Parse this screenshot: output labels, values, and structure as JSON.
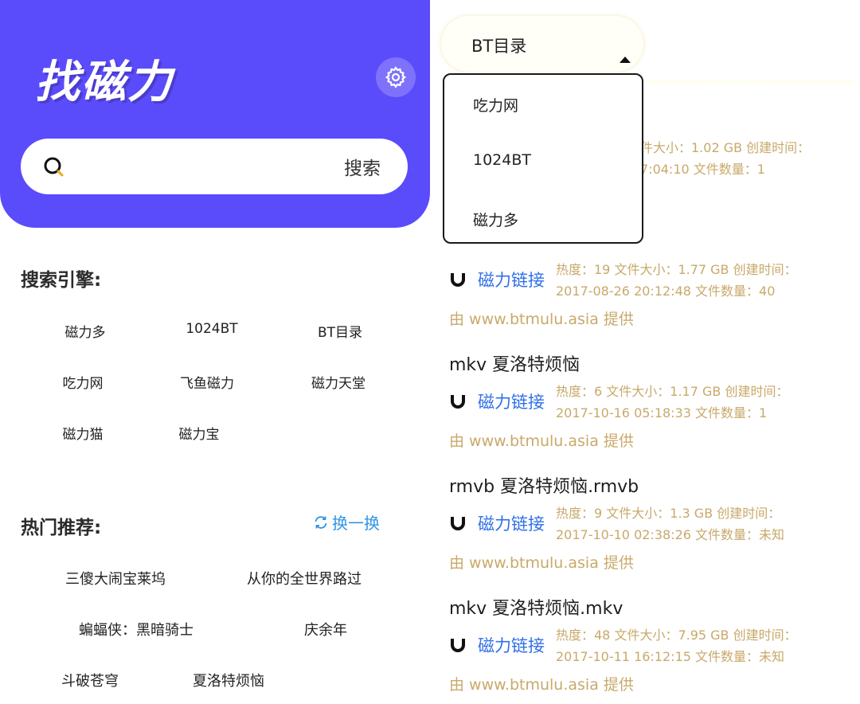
{
  "left": {
    "logo": "找磁力",
    "search": {
      "placeholder": "",
      "button": "搜索"
    },
    "engines_title": "搜索引擎:",
    "engines": [
      "磁力多",
      "1024BT",
      "BT目录",
      "吃力网",
      "飞鱼磁力",
      "磁力天堂",
      "磁力猫",
      "磁力宝"
    ],
    "hot_title": "热门推荐:",
    "refresh_label": "换一换",
    "hot": [
      "三傻大闹宝莱坞",
      "从你的全世界路过",
      "蝙蝠侠：黑暗骑士",
      "庆余年",
      "斗破苍穹",
      "夏洛特烦恼"
    ]
  },
  "right": {
    "selector": {
      "selected": "BT目录",
      "options": [
        "吃力网",
        "1024BT",
        "磁力多"
      ]
    },
    "partial_meta": {
      "line1": "件大小：1.02 GB  创建时间：",
      "line2": "7:04:10  文件数量：1"
    },
    "results": [
      {
        "title": "",
        "magnet": "磁力链接",
        "meta1": "热度：19  文件大小：1.77 GB  创建时间：",
        "meta2": "2017-08-26 20:12:48  文件数量：40",
        "source": "由 www.btmulu.asia 提供"
      },
      {
        "title": "mkv 夏洛特烦恼",
        "magnet": "磁力链接",
        "meta1": "热度：6  文件大小：1.17 GB  创建时间：",
        "meta2": "2017-10-16 05:18:33  文件数量：1",
        "source": "由 www.btmulu.asia 提供"
      },
      {
        "title": "rmvb 夏洛特烦恼.rmvb",
        "magnet": "磁力链接",
        "meta1": "热度：9  文件大小：1.3 GB  创建时间：",
        "meta2": "2017-10-10 02:38:26  文件数量：未知",
        "source": "由 www.btmulu.asia 提供"
      },
      {
        "title": "mkv 夏洛特烦恼.mkv",
        "magnet": "磁力链接",
        "meta1": "热度：48  文件大小：7.95 GB  创建时间：",
        "meta2": "2017-10-11 16:12:15  文件数量：未知",
        "source": "由 www.btmulu.asia 提供"
      }
    ]
  },
  "colors": {
    "brand": "#5a4bfb",
    "link": "#2f6fe8",
    "meta": "#c8a96a",
    "refresh": "#2f95e6"
  }
}
